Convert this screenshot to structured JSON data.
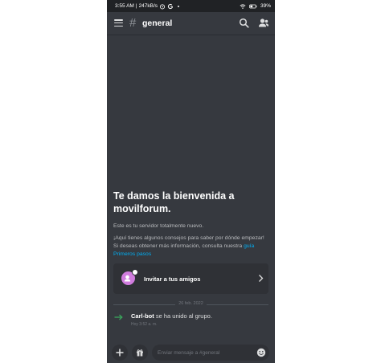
{
  "status_bar": {
    "time": "3:55 AM",
    "network_speed": "247kB/s",
    "battery": "39"
  },
  "header": {
    "channel_name": "general"
  },
  "welcome": {
    "title": "Te damos la bienvenida a movilforum.",
    "subtitle": "Este es tu servidor totalmente nuevo.",
    "description": "¡Aquí tienes algunos consejos para saber por dónde empezar! Si deseas obtener más información, consulta nuestra",
    "guide_link": "guía Primeros pasos"
  },
  "invite_card": {
    "label": "Invitar a tus amigos"
  },
  "messages": {
    "date_divider": "26 feb. 2022",
    "join_user": "Carl-bot",
    "join_text": "se ha unido al grupo.",
    "join_time": "Hoy 3:52 a. m."
  },
  "composer": {
    "placeholder": "Enviar mensaje a #general"
  },
  "colors": {
    "background": "#36393f",
    "link": "#00aff4",
    "join_arrow": "#3ba55c",
    "invite_avatar": "#d07cde"
  }
}
